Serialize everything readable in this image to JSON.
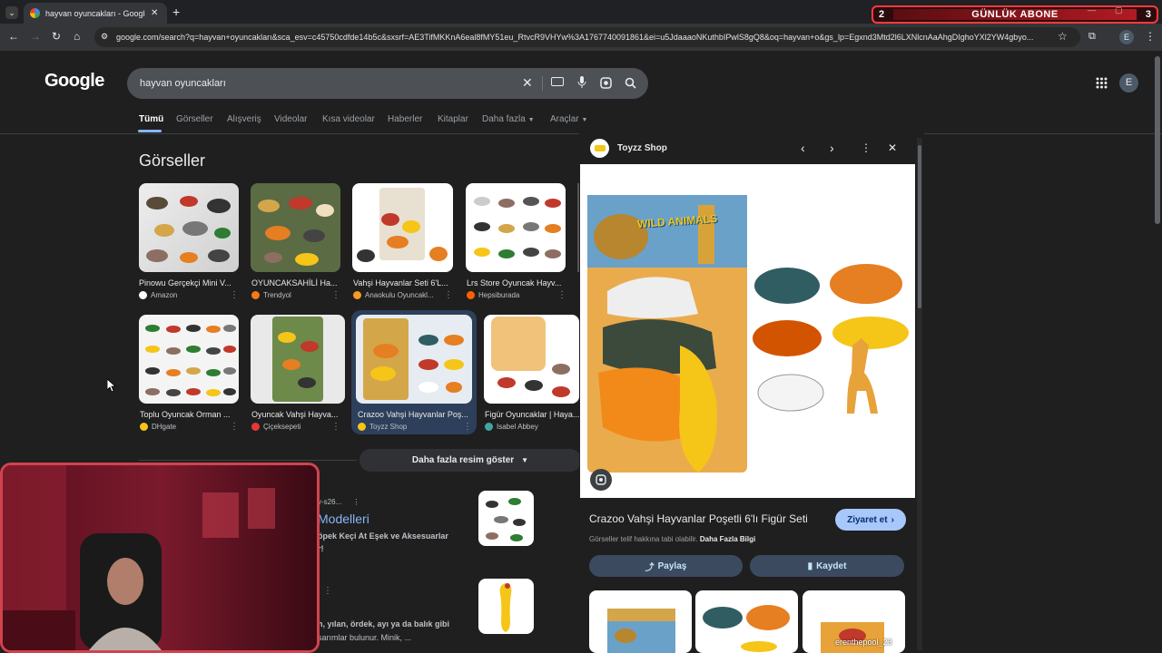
{
  "browser": {
    "tab_title": "hayvan oyuncakları - Google'da",
    "url": "google.com/search?q=hayvan+oyuncakları&sca_esv=c45750cdfde14b5c&sxsrf=AE3TifMKKnA6eal8fMY51eu_RtvcR9VHYw%3A1767740091861&ei=u5JdaaaoNKuthbIPwlS8gQ8&oq=hayvan+o&gs_lp=Egxnd3Mtd2l6LXNlcnAaAhgDIghoYXl2YW4gbyo...",
    "profile_initial": "E"
  },
  "stream_overlay": {
    "left_count": "2",
    "label": "GÜNLÜK ABONE",
    "right_count": "3"
  },
  "google": {
    "logo": "Google",
    "query": "hayvan oyuncakları",
    "tabs": [
      "Tümü",
      "Görseller",
      "Alışveriş",
      "Videolar",
      "Kısa videolar",
      "Haberler",
      "Kitaplar",
      "Daha fazla",
      "Araçlar"
    ],
    "images_heading": "Görseller",
    "row1": [
      {
        "caption": "Pinowu Gerçekçi Mini V...",
        "source": "Amazon",
        "color": "#ffffff"
      },
      {
        "caption": "OYUNCAKSAHİLİ Ha...",
        "source": "Trendyol",
        "color": "#f27a1a"
      },
      {
        "caption": "Vahşi Hayvanlar Seti 6'L...",
        "source": "Anaokulu Oyuncakl...",
        "color": "#f59b22"
      },
      {
        "caption": "Lrs Store Oyuncak Hayv...",
        "source": "Hepsiburada",
        "color": "#ff6000"
      }
    ],
    "row2": [
      {
        "caption": "Toplu Oyuncak Orman ...",
        "source": "DHgate",
        "color": "#f5c518"
      },
      {
        "caption": "Oyuncak Vahşi Hayva...",
        "source": "Çiçeksepeti",
        "color": "#e53935"
      },
      {
        "caption": "Crazoo Vahşi Hayvanlar Poş...",
        "source": "Toyzz Shop",
        "color": "#f5c518"
      },
      {
        "caption": "Figür Oyuncaklar | Haya...",
        "source": "Isabel Abbey",
        "color": "#3fa7a3"
      }
    ],
    "show_more": "Daha fazla resim göster",
    "result1": {
      "crumb": "y-s26...",
      "title": "Modelleri",
      "snippet": "öpek Keçi At Eşek ve Aksesuarlar",
      "snippet2": "r!"
    },
    "result2": {
      "snippet": "n, yılan, ördek, ayı ya da balık gibi",
      "snippet2": "sarımlar bulunur. Minik, ..."
    }
  },
  "panel": {
    "source": "Toyzz Shop",
    "title": "Crazoo Vahşi Hayvanlar Poşetli 6'lı Figür Seti",
    "visit": "Ziyaret et",
    "copyright": "Görseller telif hakkına tabi olabilir.",
    "more_info": "Daha Fazla Bilgi",
    "share": "Paylaş",
    "save": "Kaydet",
    "package_label": "WILD ANIMALS",
    "watermark": "erenthepool_23"
  }
}
